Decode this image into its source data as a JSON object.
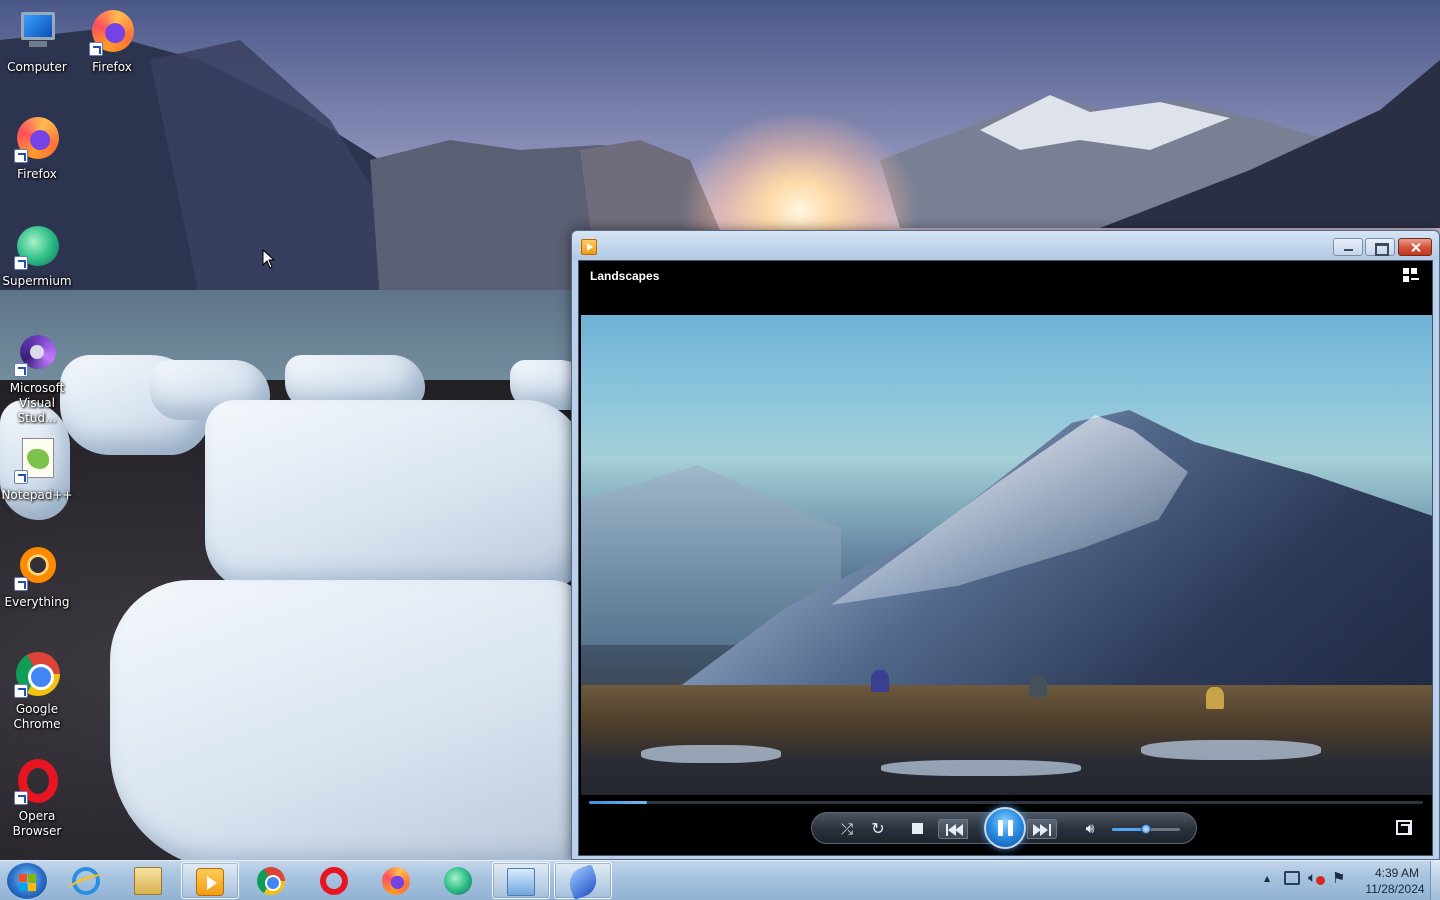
{
  "desktop": {
    "icons": [
      {
        "label": "Computer",
        "icon": "computer-icon"
      },
      {
        "label": "Firefox",
        "icon": "firefox-icon"
      },
      {
        "label": "Firefox",
        "icon": "firefox-icon"
      },
      {
        "label": "Supermium",
        "icon": "supermium-icon"
      },
      {
        "label": "Microsoft Visual Stud...",
        "icon": "visual-studio-icon"
      },
      {
        "label": "Notepad++",
        "icon": "notepad-plus-plus-icon"
      },
      {
        "label": "Everything",
        "icon": "everything-search-icon"
      },
      {
        "label": "Google Chrome",
        "icon": "chrome-icon"
      },
      {
        "label": "Opera Browser",
        "icon": "opera-icon"
      }
    ]
  },
  "player": {
    "video_title": "Landscapes",
    "playback_progress": 0.07,
    "volume_level": 0.5,
    "state": "playing",
    "accent_color": "#2c8fe6"
  },
  "taskbar": {
    "pinned": [
      {
        "name": "internet-explorer",
        "icon": "internet-explorer-icon",
        "active": false
      },
      {
        "name": "file-explorer",
        "icon": "folder-icon",
        "active": false
      },
      {
        "name": "media-player",
        "icon": "media-player-icon",
        "active": true
      },
      {
        "name": "google-chrome",
        "icon": "chrome-icon",
        "active": false
      },
      {
        "name": "opera",
        "icon": "opera-icon",
        "active": false
      },
      {
        "name": "firefox",
        "icon": "firefox-icon",
        "active": false
      },
      {
        "name": "supermium",
        "icon": "supermium-icon",
        "active": false
      },
      {
        "name": "control-panel",
        "icon": "control-panel-icon",
        "active": true
      },
      {
        "name": "feather-app",
        "icon": "feather-icon",
        "active": true
      }
    ],
    "tray": {
      "time": "4:39 AM",
      "date": "11/28/2024",
      "show_hidden_symbol": "▲",
      "volume_muted": true
    }
  }
}
